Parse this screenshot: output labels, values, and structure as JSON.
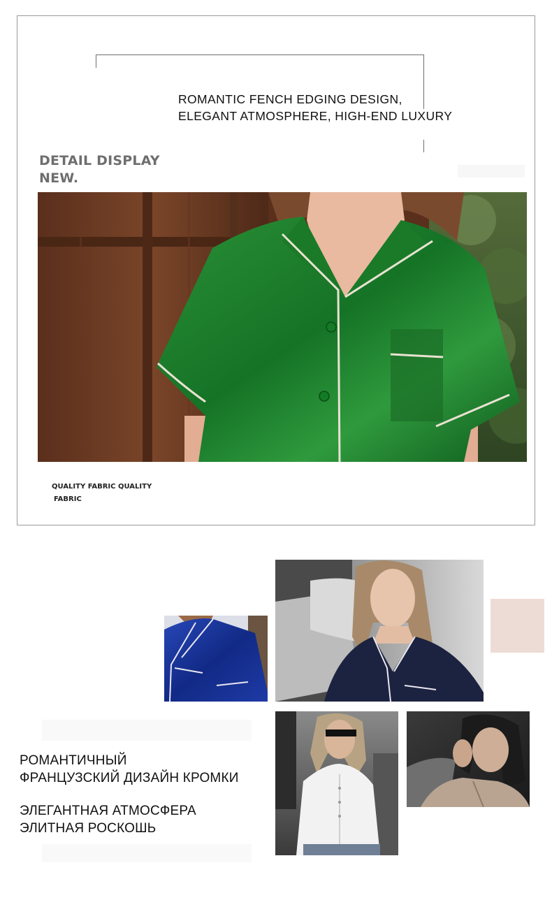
{
  "headline": {
    "line1": "ROMANTIC FENCH EDGING DESIGN,",
    "line2": "ELEGANT ATMOSPHERE, HIGH-END LUXURY"
  },
  "detail": {
    "line1": "DETAIL DISPLAY",
    "line2": "NEW."
  },
  "quality": {
    "line1": "QUALITY FABRIC QUALITY",
    "line2": "FABRIC"
  },
  "russian": {
    "block1": [
      "РОМАНТИЧНЫЙ",
      "ФРАНЦУЗСКИЙ ДИЗАЙН КРОМКИ"
    ],
    "block2": [
      "ЭЛЕГАНТНАЯ АТМОСФЕРА",
      "ЭЛИТНАЯ РОСКОШЬ"
    ]
  },
  "colors": {
    "frame_border": "#9a9a9a",
    "title_gray": "#6e6e6e",
    "satin_green": "#1f7a2a",
    "satin_blue": "#16318f",
    "satin_navy": "#1c2340",
    "swatch_blush": "#eddcd5",
    "wood_brown": "#6b3a22"
  },
  "images": {
    "main": "green-satin-pajama-shirt-photo",
    "blue": "blue-satin-pajama-photo",
    "navy": "navy-pajama-woman-on-sofa-photo",
    "white": "white-silk-shirt-woman-street-photo",
    "asian": "woman-in-satin-blouse-photo",
    "swatch": "blush-fabric-swatch"
  }
}
